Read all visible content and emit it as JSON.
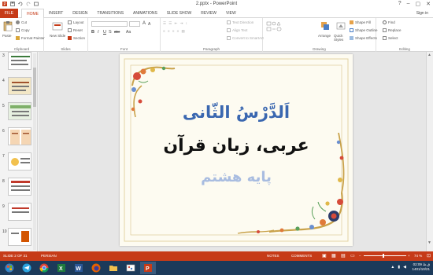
{
  "titlebar": {
    "title": "2.pptx - PowerPoint",
    "minimize": "–",
    "restore": "▢",
    "close": "✕",
    "help": "?"
  },
  "tabs": {
    "file": "FILE",
    "items": [
      "HOME",
      "INSERT",
      "DESIGN",
      "TRANSITIONS",
      "ANIMATIONS",
      "SLIDE SHOW",
      "REVIEW",
      "VIEW"
    ],
    "active": "HOME",
    "signin": "Sign in"
  },
  "ribbon": {
    "clipboard": {
      "paste": "Paste",
      "cut": "Cut",
      "copy": "Copy",
      "format_painter": "Format Painter",
      "label": "Clipboard"
    },
    "slides": {
      "new_slide": "New Slide",
      "layout": "Layout",
      "reset": "Reset",
      "section": "Section",
      "label": "Slides"
    },
    "font": {
      "label": "Font",
      "bold": "B",
      "italic": "I",
      "underline": "U",
      "strike": "S",
      "shadow": "abc",
      "case": "Aa",
      "size_up": "A",
      "size_down": "A"
    },
    "paragraph": {
      "text_direction": "Text Direction",
      "align_text": "Align Text",
      "smartart": "Convert to SmartArt",
      "label": "Paragraph"
    },
    "drawing": {
      "arrange": "Arrange",
      "quick_styles": "Quick Styles",
      "shape_fill": "Shape Fill",
      "shape_outline": "Shape Outline",
      "shape_effects": "Shape Effects",
      "label": "Drawing"
    },
    "editing": {
      "find": "Find",
      "replace": "Replace",
      "select": "Select",
      "label": "Editing"
    }
  },
  "thumbnails": [
    {
      "number": "3"
    },
    {
      "number": "4"
    },
    {
      "number": "5"
    },
    {
      "number": "6"
    },
    {
      "number": "7"
    },
    {
      "number": "8"
    },
    {
      "number": "9"
    },
    {
      "number": "10"
    }
  ],
  "slide": {
    "line1": "اَلدَّرْسُ الثّانی",
    "line2": "عربی، زبان قرآن",
    "line3": "پایه هشتم",
    "colors": {
      "line1": "#3a67b0",
      "line2": "#111111",
      "line3": "#a8bce0",
      "frame": "#c9a24a",
      "background": "#fdfbf1"
    }
  },
  "status": {
    "slide_of": "SLIDE 2 OF 31",
    "language": "PERSIAN",
    "notes": "NOTES",
    "comments": "COMMENTS",
    "zoom": "74 %"
  },
  "taskbar": {
    "apps": [
      "start",
      "telegram",
      "chrome",
      "excel",
      "word",
      "firefox",
      "explorer",
      "paint",
      "powerpoint"
    ],
    "time": "02:09 ق.ظ",
    "date": "1401/10/21"
  },
  "colors": {
    "accent": "#c63b18",
    "taskbar": "#1c3a5a"
  }
}
